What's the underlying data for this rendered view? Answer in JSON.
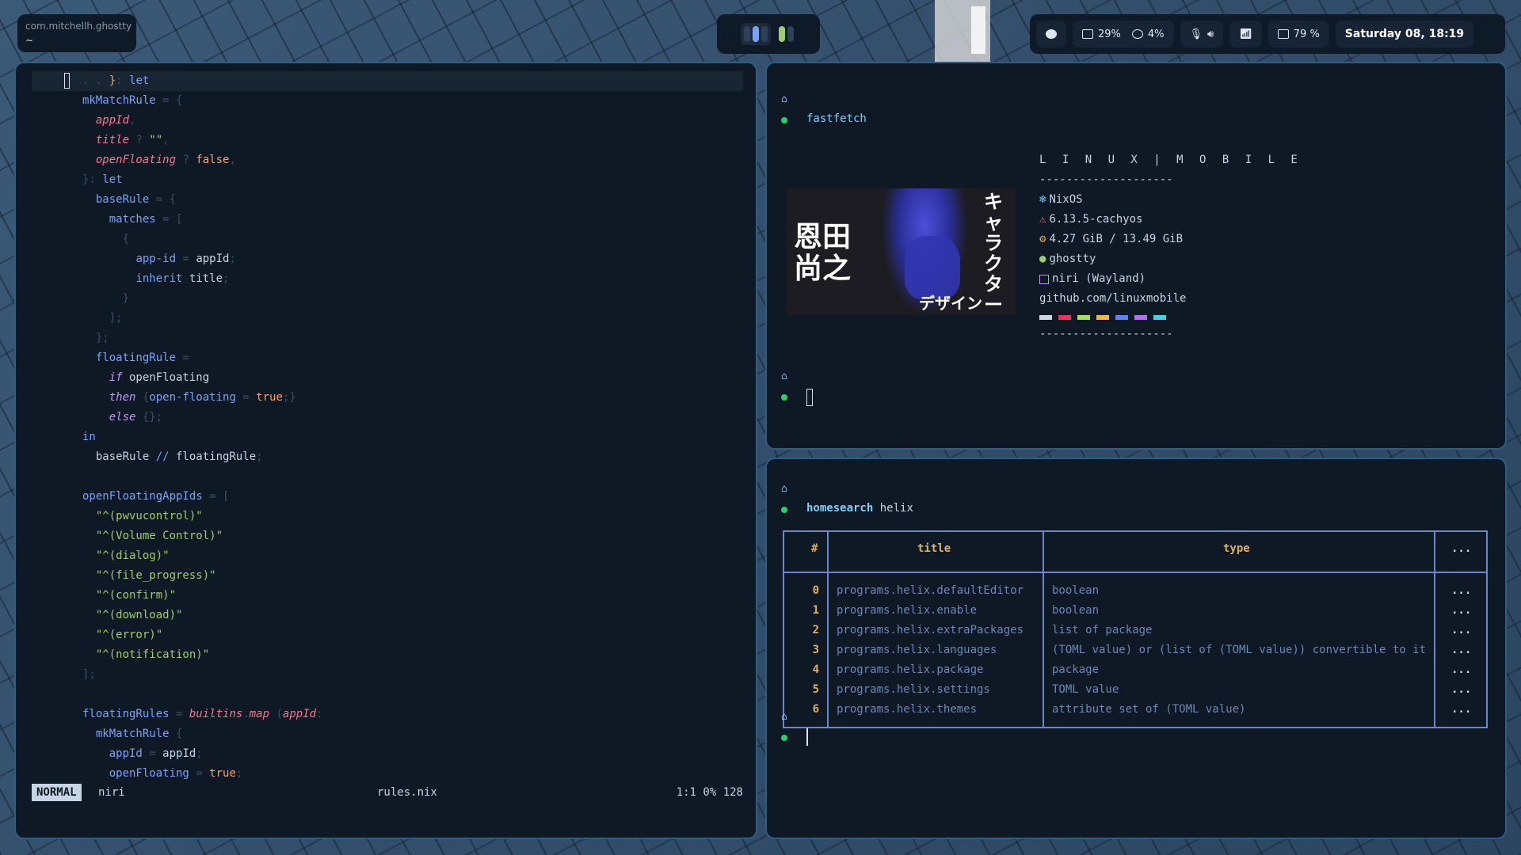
{
  "topbar": {
    "focused_app": "com.mitchellh.ghostty",
    "focused_path": "~",
    "status": {
      "cpu": "29%",
      "memory": "4%",
      "battery": "79 %",
      "clock": "Saturday 08, 18:19"
    },
    "icons": [
      "github-icon",
      "monitor-icon",
      "chip-icon",
      "mic-muted-icon",
      "volume-icon",
      "wifi-icon",
      "battery-icon"
    ]
  },
  "editor": {
    "lines": [
      {
        "parts": [
          [
            "k-dim",
            ". . "
          ],
          [
            "k-yel",
            "}"
          ],
          [
            "k-dim",
            ": "
          ],
          [
            "k-blue",
            "let"
          ]
        ]
      },
      {
        "parts": [
          [
            "k-blue",
            "mkMatchRule"
          ],
          [
            "k-dim",
            " = {"
          ]
        ]
      },
      {
        "parts": [
          [
            "k-plain",
            "  "
          ],
          [
            "k-red",
            "appId"
          ],
          [
            "k-dim",
            ","
          ]
        ]
      },
      {
        "parts": [
          [
            "k-plain",
            "  "
          ],
          [
            "k-red",
            "title"
          ],
          [
            "k-dim",
            " ? "
          ],
          [
            "k-str",
            "\"\""
          ],
          [
            "k-dim",
            ","
          ]
        ]
      },
      {
        "parts": [
          [
            "k-plain",
            "  "
          ],
          [
            "k-red",
            "openFloating"
          ],
          [
            "k-dim",
            " ? "
          ],
          [
            "k-org",
            "false"
          ],
          [
            "k-dim",
            ","
          ]
        ]
      },
      {
        "parts": [
          [
            "k-dim",
            "}: "
          ],
          [
            "k-blue",
            "let"
          ]
        ]
      },
      {
        "parts": [
          [
            "k-plain",
            "  "
          ],
          [
            "k-blue",
            "baseRule"
          ],
          [
            "k-dim",
            " = {"
          ]
        ]
      },
      {
        "parts": [
          [
            "k-plain",
            "    "
          ],
          [
            "k-blue",
            "matches"
          ],
          [
            "k-dim",
            " = ["
          ]
        ]
      },
      {
        "parts": [
          [
            "k-dim",
            "      {"
          ]
        ]
      },
      {
        "parts": [
          [
            "k-plain",
            "        "
          ],
          [
            "k-blue",
            "app-id"
          ],
          [
            "k-dim",
            " = "
          ],
          [
            "k-plain",
            "appId"
          ],
          [
            "k-dim",
            ";"
          ]
        ]
      },
      {
        "parts": [
          [
            "k-plain",
            "        "
          ],
          [
            "k-blue",
            "inherit"
          ],
          [
            "k-plain",
            " title"
          ],
          [
            "k-dim",
            ";"
          ]
        ]
      },
      {
        "parts": [
          [
            "k-dim",
            "      }"
          ]
        ]
      },
      {
        "parts": [
          [
            "k-dim",
            "    ];"
          ]
        ]
      },
      {
        "parts": [
          [
            "k-dim",
            "  };"
          ]
        ]
      },
      {
        "parts": [
          [
            "k-plain",
            "  "
          ],
          [
            "k-blue",
            "floatingRule"
          ],
          [
            "k-dim",
            " ="
          ]
        ]
      },
      {
        "parts": [
          [
            "k-plain",
            "    "
          ],
          [
            "k-ital",
            "if"
          ],
          [
            "k-plain",
            " openFloating"
          ]
        ]
      },
      {
        "parts": [
          [
            "k-plain",
            "    "
          ],
          [
            "k-ital",
            "then"
          ],
          [
            "k-dim",
            " {"
          ],
          [
            "k-blue",
            "open-floating"
          ],
          [
            "k-dim",
            " = "
          ],
          [
            "k-org",
            "true"
          ],
          [
            "k-dim",
            ";}"
          ]
        ]
      },
      {
        "parts": [
          [
            "k-plain",
            "    "
          ],
          [
            "k-ital",
            "else"
          ],
          [
            "k-dim",
            " {};"
          ]
        ]
      },
      {
        "parts": [
          [
            "k-blue",
            "in"
          ]
        ]
      },
      {
        "parts": [
          [
            "k-plain",
            "  baseRule "
          ],
          [
            "k-blue",
            "//"
          ],
          [
            "k-plain",
            " floatingRule"
          ],
          [
            "k-dim",
            ";"
          ]
        ]
      },
      {
        "parts": [
          [
            "k-plain",
            ""
          ]
        ]
      },
      {
        "parts": [
          [
            "k-blue",
            "openFloatingAppIds"
          ],
          [
            "k-dim",
            " = ["
          ]
        ]
      },
      {
        "parts": [
          [
            "k-plain",
            "  "
          ],
          [
            "k-str",
            "\"^(pwvucontrol)\""
          ]
        ]
      },
      {
        "parts": [
          [
            "k-plain",
            "  "
          ],
          [
            "k-str",
            "\"^(Volume Control)\""
          ]
        ]
      },
      {
        "parts": [
          [
            "k-plain",
            "  "
          ],
          [
            "k-str",
            "\"^(dialog)\""
          ]
        ]
      },
      {
        "parts": [
          [
            "k-plain",
            "  "
          ],
          [
            "k-str",
            "\"^(file_progress)\""
          ]
        ]
      },
      {
        "parts": [
          [
            "k-plain",
            "  "
          ],
          [
            "k-str",
            "\"^(confirm)\""
          ]
        ]
      },
      {
        "parts": [
          [
            "k-plain",
            "  "
          ],
          [
            "k-str",
            "\"^(download)\""
          ]
        ]
      },
      {
        "parts": [
          [
            "k-plain",
            "  "
          ],
          [
            "k-str",
            "\"^(error)\""
          ]
        ]
      },
      {
        "parts": [
          [
            "k-plain",
            "  "
          ],
          [
            "k-str",
            "\"^(notification)\""
          ]
        ]
      },
      {
        "parts": [
          [
            "k-dim",
            "];"
          ]
        ]
      },
      {
        "parts": [
          [
            "k-plain",
            ""
          ]
        ]
      },
      {
        "parts": [
          [
            "k-blue",
            "floatingRules"
          ],
          [
            "k-dim",
            " = "
          ],
          [
            "k-red",
            "builtins"
          ],
          [
            "k-dim",
            "."
          ],
          [
            "k-red",
            "map"
          ],
          [
            "k-dim",
            " ("
          ],
          [
            "k-red",
            "appId"
          ],
          [
            "k-dim",
            ":"
          ]
        ]
      },
      {
        "parts": [
          [
            "k-plain",
            "  "
          ],
          [
            "k-blue",
            "mkMatchRule"
          ],
          [
            "k-dim",
            " {"
          ]
        ]
      },
      {
        "parts": [
          [
            "k-plain",
            "    "
          ],
          [
            "k-blue",
            "appId"
          ],
          [
            "k-dim",
            " = "
          ],
          [
            "k-plain",
            "appId"
          ],
          [
            "k-dim",
            ";"
          ]
        ]
      },
      {
        "parts": [
          [
            "k-plain",
            "    "
          ],
          [
            "k-blue",
            "openFloating"
          ],
          [
            "k-dim",
            " = "
          ],
          [
            "k-org",
            "true"
          ],
          [
            "k-dim",
            ";"
          ]
        ]
      }
    ],
    "statusline": {
      "mode": "NORMAL",
      "workspace": "niri",
      "file": "rules.nix",
      "position": "1:1 0% 128"
    }
  },
  "term1": {
    "home_glyph": "⌂",
    "command": "fastfetch",
    "image_text": {
      "left": "恩田尚之",
      "right": "キャラクター",
      "bottom": "デザイン"
    },
    "info": {
      "header": "L I N U X | M O B I L E",
      "separator": "--------------------",
      "os": "NixOS",
      "kernel": "6.13.5-cachyos",
      "memory": "4.27 GiB / 13.49 GiB",
      "terminal": "ghostty",
      "wm": "niri (Wayland)",
      "url": "github.com/linuxmobile"
    },
    "palette": [
      "#d0d6e0",
      "#f7305f",
      "#a6e05a",
      "#f5b73b",
      "#5a86f0",
      "#b86cf0",
      "#45d0e8"
    ]
  },
  "term2": {
    "home_glyph": "⌂",
    "command": "homesearch",
    "command_arg": "helix",
    "table": {
      "headers": {
        "index": "#",
        "title": "title",
        "type": "type",
        "more": "..."
      },
      "rows": [
        {
          "i": "0",
          "title": "programs.helix.defaultEditor",
          "type": "boolean",
          "more": "..."
        },
        {
          "i": "1",
          "title": "programs.helix.enable",
          "type": "boolean",
          "more": "..."
        },
        {
          "i": "2",
          "title": "programs.helix.extraPackages",
          "type": "list of package",
          "more": "..."
        },
        {
          "i": "3",
          "title": "programs.helix.languages",
          "type": "(TOML value) or (list of (TOML value)) convertible to it",
          "more": "..."
        },
        {
          "i": "4",
          "title": "programs.helix.package",
          "type": "package",
          "more": "..."
        },
        {
          "i": "5",
          "title": "programs.helix.settings",
          "type": "TOML value",
          "more": "..."
        },
        {
          "i": "6",
          "title": "programs.helix.themes",
          "type": "attribute set of (TOML value)",
          "more": "..."
        }
      ]
    }
  }
}
